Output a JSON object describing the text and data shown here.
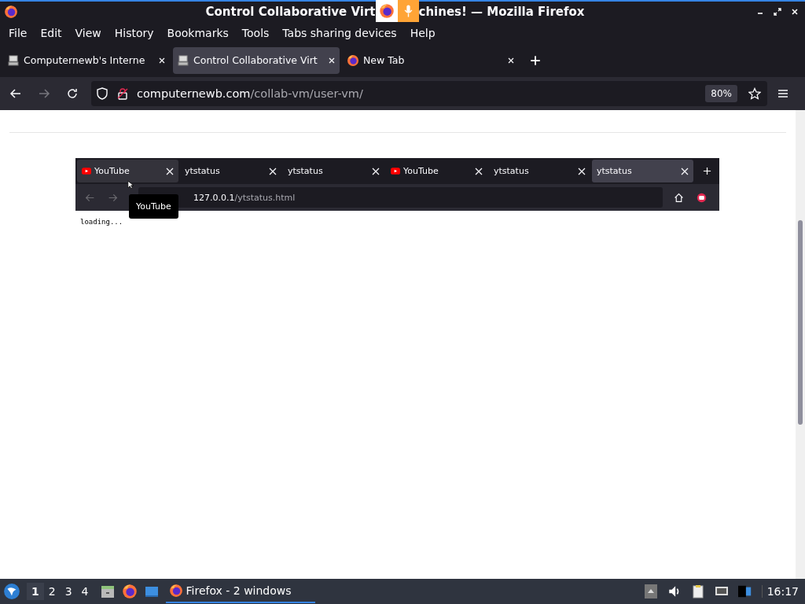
{
  "window": {
    "title_start": "Control Collaborative Virt",
    "title_end": "chines! — Mozilla Firefox",
    "sharing_indicator": {
      "microphone": true
    }
  },
  "menu": [
    "File",
    "Edit",
    "View",
    "History",
    "Bookmarks",
    "Tools",
    "Tabs sharing devices",
    "Help"
  ],
  "tabs": [
    {
      "label": "Computernewb's Interne",
      "selected": false,
      "kind": "vm"
    },
    {
      "label": "Control Collaborative Virt",
      "selected": true,
      "kind": "vm"
    },
    {
      "label": "New Tab",
      "selected": false,
      "kind": "firefox"
    }
  ],
  "address": {
    "host": "computernewb.com",
    "path": "/collab-vm/user-vm/",
    "zoom": "80%"
  },
  "vm_screen": {
    "tabs": [
      {
        "label": "YouTube",
        "selected": false,
        "hovered": true,
        "kind": "youtube"
      },
      {
        "label": "ytstatus",
        "selected": false,
        "hovered": false,
        "kind": "plain"
      },
      {
        "label": "ytstatus",
        "selected": false,
        "hovered": false,
        "kind": "plain"
      },
      {
        "label": "YouTube",
        "selected": false,
        "hovered": false,
        "kind": "youtube"
      },
      {
        "label": "ytstatus",
        "selected": false,
        "hovered": false,
        "kind": "plain"
      },
      {
        "label": "ytstatus",
        "selected": true,
        "hovered": false,
        "kind": "plain"
      }
    ],
    "address": {
      "host": "127.0.0.1",
      "path": "/ytstatus.html"
    },
    "tooltip": "YouTube",
    "page_text": "loading..."
  },
  "taskbar": {
    "workspaces": [
      {
        "label": "1",
        "selected": true
      },
      {
        "label": "2",
        "selected": false
      },
      {
        "label": "3",
        "selected": false
      },
      {
        "label": "4",
        "selected": false
      }
    ],
    "task": {
      "label": "Firefox - 2 windows",
      "selected": true
    },
    "clock": "16:17"
  }
}
